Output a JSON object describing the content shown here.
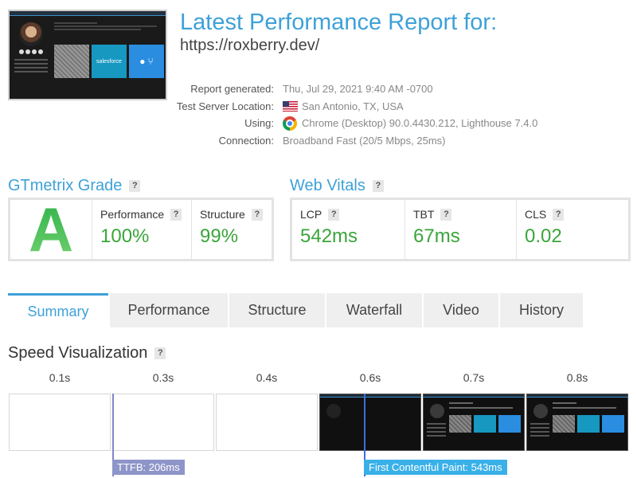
{
  "header": {
    "title": "Latest Performance Report for:",
    "url": "https://roxberry.dev/",
    "thumbnail_card_label": "salesforce"
  },
  "meta": [
    {
      "key": "Report generated:",
      "value": "Thu, Jul 29, 2021 9:40 AM -0700",
      "icon": ""
    },
    {
      "key": "Test Server Location:",
      "value": "San Antonio, TX, USA",
      "icon": "us-flag-icon"
    },
    {
      "key": "Using:",
      "value": "Chrome (Desktop) 90.0.4430.212, Lighthouse 7.4.0",
      "icon": "chrome-icon"
    },
    {
      "key": "Connection:",
      "value": "Broadband Fast (20/5 Mbps, 25ms)",
      "icon": ""
    }
  ],
  "grade": {
    "title": "GTmetrix Grade",
    "help": "?",
    "letter": "A",
    "performance_label": "Performance",
    "performance_value": "100%",
    "structure_label": "Structure",
    "structure_value": "99%"
  },
  "vitals": {
    "title": "Web Vitals",
    "help": "?",
    "items": [
      {
        "label": "LCP",
        "value": "542ms"
      },
      {
        "label": "TBT",
        "value": "67ms"
      },
      {
        "label": "CLS",
        "value": "0.02"
      }
    ]
  },
  "tabs": [
    "Summary",
    "Performance",
    "Structure",
    "Waterfall",
    "Video",
    "History"
  ],
  "active_tab": "Summary",
  "speed": {
    "title": "Speed Visualization",
    "help": "?",
    "frame_times": [
      "0.1s",
      "0.3s",
      "0.4s",
      "0.6s",
      "0.7s",
      "0.8s"
    ],
    "ttfb_label": "TTFB: 206ms",
    "fcp_label": "First Contentful Paint: 543ms"
  },
  "colors": {
    "accent": "#3ea1d8",
    "good": "#3aa53a",
    "ttfb": "#8e95c9",
    "fcp": "#39b0e8"
  }
}
